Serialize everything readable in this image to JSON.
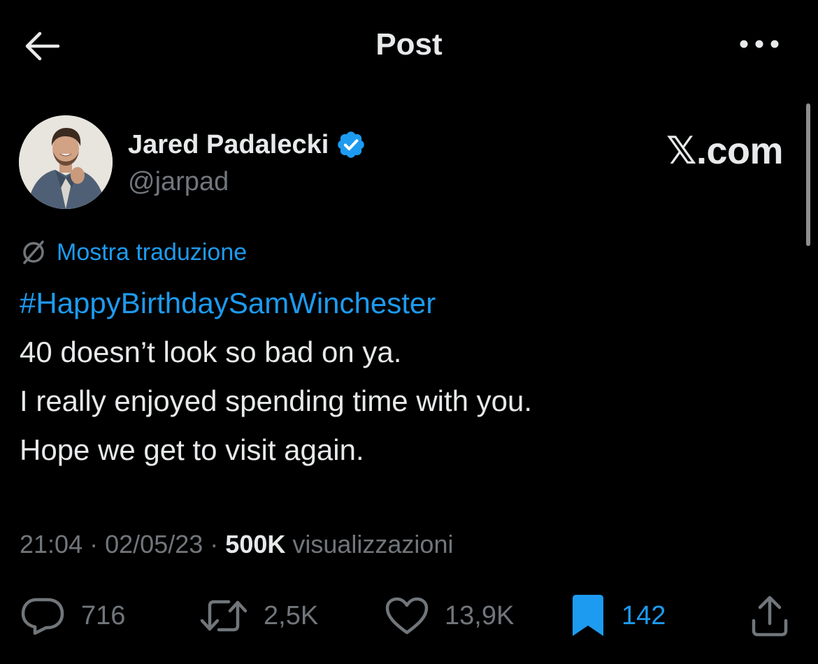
{
  "header": {
    "title": "Post"
  },
  "author": {
    "name": "Jared Padalecki",
    "handle": "@jarpad",
    "verified": true
  },
  "watermark": "𝕏.com",
  "translate": {
    "label": "Mostra traduzione"
  },
  "tweet": {
    "hashtag": "#HappyBirthdaySamWinchester",
    "lines": [
      "40 doesn’t look so bad on ya.",
      "I really enjoyed spending time with you.",
      "Hope we get to visit again."
    ]
  },
  "meta": {
    "time": "21:04",
    "separator": "·",
    "date": "02/05/23",
    "views_count": "500K",
    "views_label": "visualizzazioni"
  },
  "actions": {
    "replies": "716",
    "reposts": "2,5K",
    "likes": "13,9K",
    "bookmarks": "142"
  },
  "colors": {
    "background": "#000000",
    "text": "#e7e9ea",
    "secondary": "#71767b",
    "accent": "#1d9bf0"
  },
  "icons": [
    "back-arrow-icon",
    "more-icon",
    "verified-badge-icon",
    "translate-icon",
    "reply-icon",
    "repost-icon",
    "like-icon",
    "bookmark-icon",
    "share-icon"
  ]
}
